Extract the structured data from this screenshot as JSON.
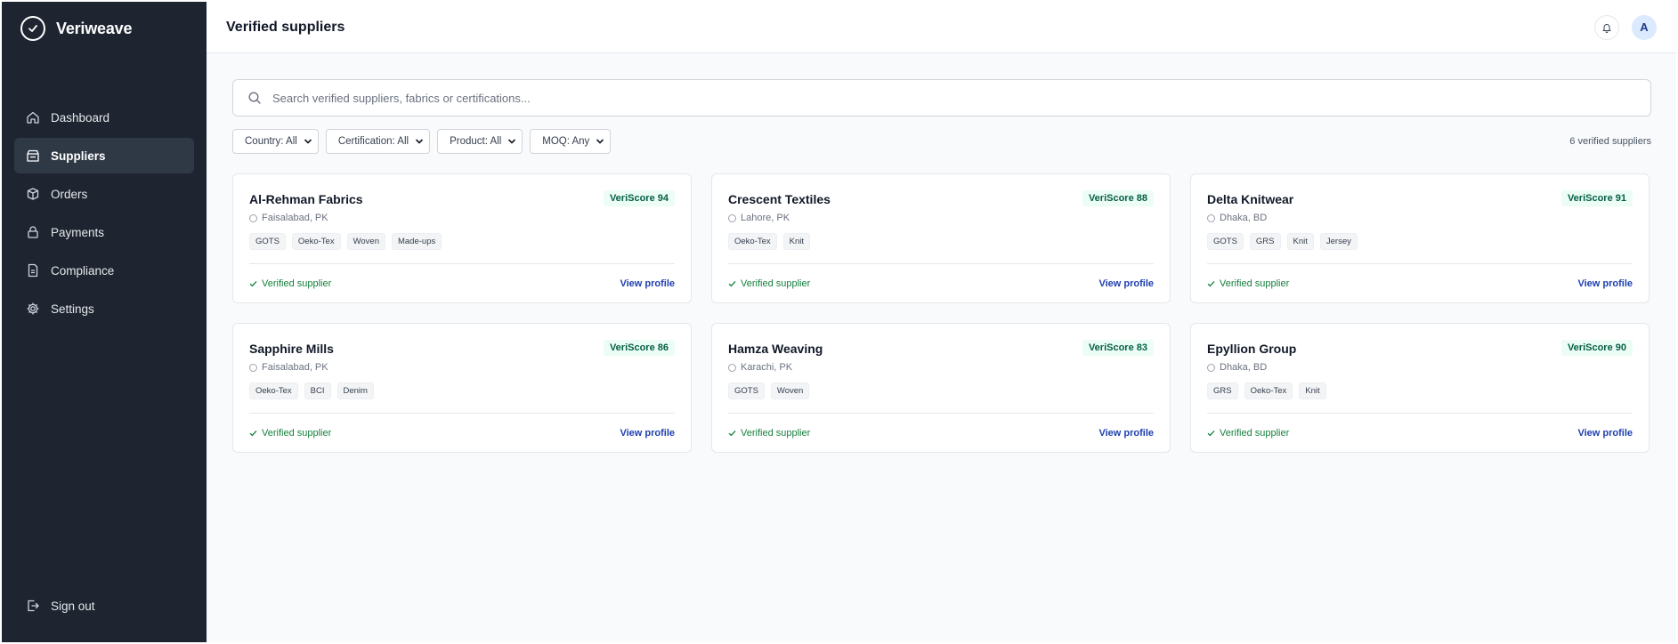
{
  "brand": {
    "name": "Veriweave",
    "icon": "check-circle-icon"
  },
  "sidebar": {
    "items": [
      {
        "label": "Dashboard",
        "icon": "home-icon",
        "active": false
      },
      {
        "label": "Suppliers",
        "icon": "store-icon",
        "active": true
      },
      {
        "label": "Orders",
        "icon": "box-icon",
        "active": false
      },
      {
        "label": "Payments",
        "icon": "lock-icon",
        "active": false
      },
      {
        "label": "Compliance",
        "icon": "document-icon",
        "active": false
      },
      {
        "label": "Settings",
        "icon": "gear-icon",
        "active": false
      }
    ],
    "signout": {
      "label": "Sign out",
      "icon": "sign-out-icon"
    }
  },
  "header": {
    "title": "Verified suppliers",
    "avatar_initial": "A",
    "bell_icon": "bell-icon"
  },
  "search": {
    "placeholder": "Search verified suppliers, fabrics or certifications...",
    "value": ""
  },
  "filters": [
    {
      "label": "Country: All"
    },
    {
      "label": "Certification: All"
    },
    {
      "label": "Product: All"
    },
    {
      "label": "MOQ: Any"
    }
  ],
  "result_count": "6 verified suppliers",
  "suppliers": [
    {
      "name": "Al-Rehman Fabrics",
      "score": "VeriScore 94",
      "location": "Faisalabad, PK",
      "tags": [
        "GOTS",
        "Oeko-Tex",
        "Woven",
        "Made-ups"
      ],
      "status": "Verified supplier",
      "link": "View profile"
    },
    {
      "name": "Crescent Textiles",
      "score": "VeriScore 88",
      "location": "Lahore, PK",
      "tags": [
        "Oeko-Tex",
        "Knit"
      ],
      "status": "Verified supplier",
      "link": "View profile"
    },
    {
      "name": "Delta Knitwear",
      "score": "VeriScore 91",
      "location": "Dhaka, BD",
      "tags": [
        "GOTS",
        "GRS",
        "Knit",
        "Jersey"
      ],
      "status": "Verified supplier",
      "link": "View profile"
    },
    {
      "name": "Sapphire Mills",
      "score": "VeriScore 86",
      "location": "Faisalabad, PK",
      "tags": [
        "Oeko-Tex",
        "BCI",
        "Denim"
      ],
      "status": "Verified supplier",
      "link": "View profile"
    },
    {
      "name": "Hamza Weaving",
      "score": "VeriScore 83",
      "location": "Karachi, PK",
      "tags": [
        "GOTS",
        "Woven"
      ],
      "status": "Verified supplier",
      "link": "View profile"
    },
    {
      "name": "Epyllion Group",
      "score": "VeriScore 90",
      "location": "Dhaka, BD",
      "tags": [
        "GRS",
        "Oeko-Tex",
        "Knit"
      ],
      "status": "Verified supplier",
      "link": "View profile"
    }
  ],
  "colors": {
    "sidebar_bg": "#1e2530",
    "active_item_bg": "#2f3946",
    "score_text": "#065f46",
    "verified_text": "#15803d",
    "link_text": "#1e40af"
  }
}
